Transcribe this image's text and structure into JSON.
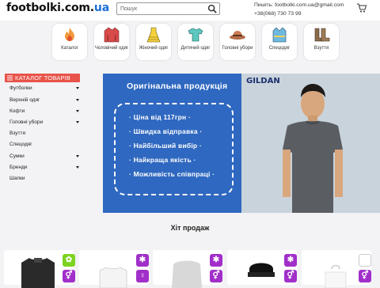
{
  "header": {
    "logo_main": "footbolki.",
    "logo_mid": "com.",
    "logo_tld": "ua",
    "search_placeholder": "Пошук",
    "email_line": "Пишіть: footbolki.com.ua@gmail.com",
    "phone_line": "+38(068) 730 73 99"
  },
  "categories": [
    {
      "label": "Каталог",
      "icon": "flame-icon"
    },
    {
      "label": "Чоловічий одяг",
      "icon": "jacket-icon"
    },
    {
      "label": "Жіночий одяг",
      "icon": "dress-icon"
    },
    {
      "label": "Дитячий одяг",
      "icon": "tshirt-icon"
    },
    {
      "label": "Головні убори",
      "icon": "hat-icon"
    },
    {
      "label": "Спецодяг",
      "icon": "vest-icon"
    },
    {
      "label": "Взуття",
      "icon": "boots-icon"
    }
  ],
  "sidebar": {
    "title": "КАТАЛОГ ТОВАРІВ",
    "items": [
      {
        "label": "Футболки",
        "has_sub": true
      },
      {
        "label": "Верхній одяг",
        "has_sub": true
      },
      {
        "label": "Кофти",
        "has_sub": true
      },
      {
        "label": "Головні убори",
        "has_sub": true
      },
      {
        "label": "Взуття",
        "has_sub": false
      },
      {
        "label": "Спецодяг",
        "has_sub": false
      },
      {
        "label": "Сумки",
        "has_sub": true
      },
      {
        "label": "Бренди",
        "has_sub": true
      },
      {
        "label": "Шапки",
        "has_sub": false
      }
    ]
  },
  "banner": {
    "title": "Оригінальна продукція",
    "brand": "GILDAN",
    "items": [
      "Ціна від 117грн",
      "Швидка відправка",
      "Найбільший вибір",
      "Найкраща якість",
      "Можливість співпраці"
    ],
    "bg_color": "#2f68c0"
  },
  "section_title": "Хіт продаж",
  "colors": {
    "accent": "#e8534a",
    "badge_green": "#7ed321",
    "badge_purple": "#a12fc9",
    "brand_blue": "#1a6fd4"
  }
}
